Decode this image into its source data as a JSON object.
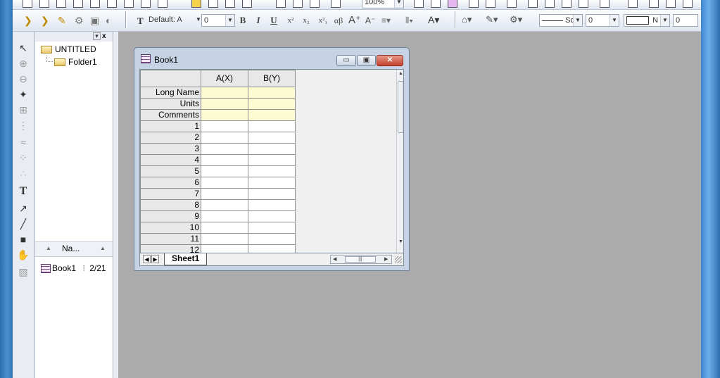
{
  "toolbar": {
    "zoom_value": "100%",
    "font_combo": "Default: A",
    "font_size_combo": "0",
    "line_style_combo": "Sc",
    "line_width_combo": "0",
    "border_combo": "N",
    "border_width_combo": "0",
    "format_buttons": [
      "B",
      "I",
      "U",
      "x²",
      "x₂",
      "x²₁",
      "αβ",
      "A⁺",
      "A⁻"
    ]
  },
  "explorer": {
    "root": "UNTITLED",
    "folder": "Folder1",
    "list_header_name": "Na...",
    "list_item_name": "Book1",
    "list_item_date": "2/21"
  },
  "book_window": {
    "title": "Book1",
    "columns": [
      "A(X)",
      "B(Y)"
    ],
    "row_headers": [
      "Long Name",
      "Units",
      "Comments"
    ],
    "rows": [
      "1",
      "2",
      "3",
      "4",
      "5",
      "6",
      "7",
      "8",
      "9",
      "10",
      "11",
      "12"
    ],
    "sheet_tab": "Sheet1"
  },
  "colors": {
    "workspace": "#ababab",
    "meta_cells": "#fdfbd1"
  }
}
